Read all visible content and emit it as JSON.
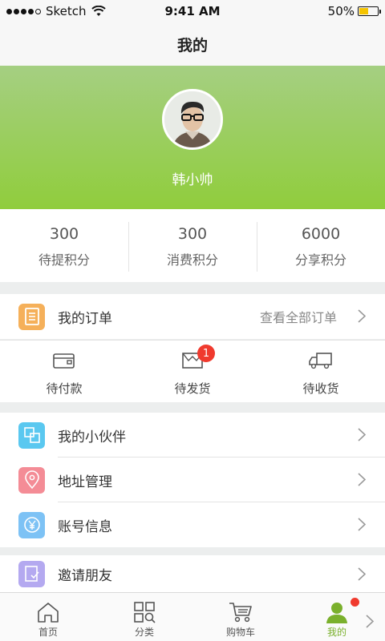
{
  "status_bar": {
    "carrier": "Sketch",
    "time": "9:41 AM",
    "battery": "50%"
  },
  "nav": {
    "title": "我的"
  },
  "profile": {
    "username": "韩小帅"
  },
  "points": [
    {
      "value": "300",
      "label": "待提积分"
    },
    {
      "value": "300",
      "label": "消费积分"
    },
    {
      "value": "6000",
      "label": "分享积分"
    }
  ],
  "orders": {
    "title": "我的订单",
    "view_all": "查看全部订单",
    "statuses": [
      {
        "label": "待付款"
      },
      {
        "label": "待发货",
        "badge": "1"
      },
      {
        "label": "待收货"
      }
    ]
  },
  "menu": [
    {
      "label": "我的小伙伴",
      "icon": "partners-icon",
      "color": "#5ac8f0"
    },
    {
      "label": "地址管理",
      "icon": "location-icon",
      "color": "#f48c96"
    },
    {
      "label": "账号信息",
      "icon": "yen-icon",
      "color": "#7dc2f5"
    }
  ],
  "invite": {
    "label": "邀请朋友",
    "icon": "invite-icon",
    "color": "#b4a9f0"
  },
  "tabbar": {
    "items": [
      {
        "label": "首页",
        "icon": "home-icon"
      },
      {
        "label": "分类",
        "icon": "category-icon"
      },
      {
        "label": "购物车",
        "icon": "cart-icon"
      },
      {
        "label": "我的",
        "icon": "user-icon",
        "active": true
      }
    ]
  },
  "colors": {
    "accent": "#7ab02c",
    "badge": "#f03a2e",
    "order_icon": "#f5b05a"
  }
}
